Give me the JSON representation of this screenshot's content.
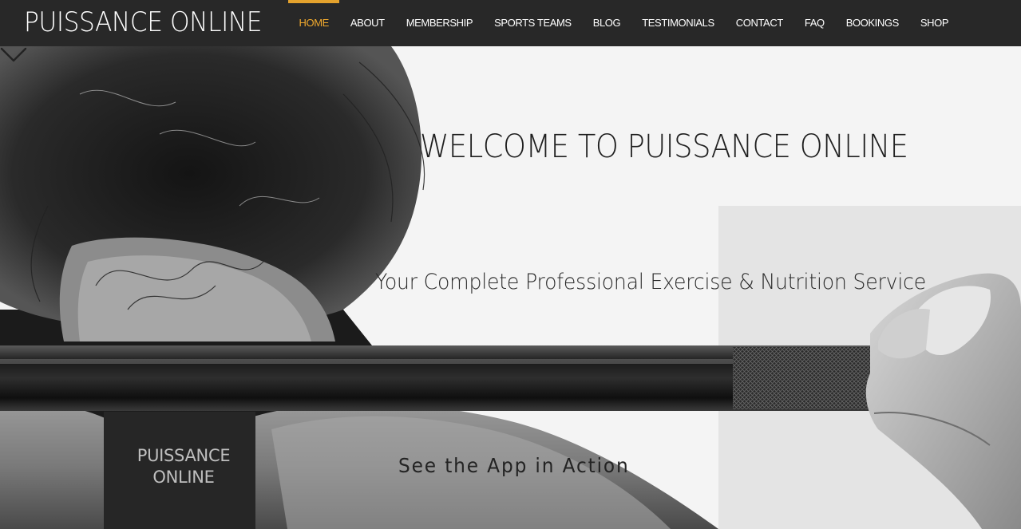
{
  "brand": "PUISSANCE ONLINE",
  "nav": {
    "items": [
      {
        "label": "HOME",
        "active": true
      },
      {
        "label": "ABOUT"
      },
      {
        "label": "MEMBERSHIP"
      },
      {
        "label": "SPORTS TEAMS"
      },
      {
        "label": "BLOG"
      },
      {
        "label": "TESTIMONIALS"
      },
      {
        "label": "CONTACT"
      },
      {
        "label": "FAQ"
      },
      {
        "label": "BOOKINGS"
      },
      {
        "label": "SHOP"
      }
    ]
  },
  "hero": {
    "title": "WELCOME TO PUISSANCE ONLINE",
    "subtitle": "Your Complete Professional Exercise & Nutrition Service",
    "cta_label": "See the App in Action",
    "cta_icon": "chevron-down-icon",
    "strap_logo_line1": "PUISSANCE",
    "strap_logo_line2": "ONLINE"
  },
  "colors": {
    "header_bg": "#282828",
    "active_accent": "#e4a22d",
    "nav_text": "#ffffff"
  }
}
